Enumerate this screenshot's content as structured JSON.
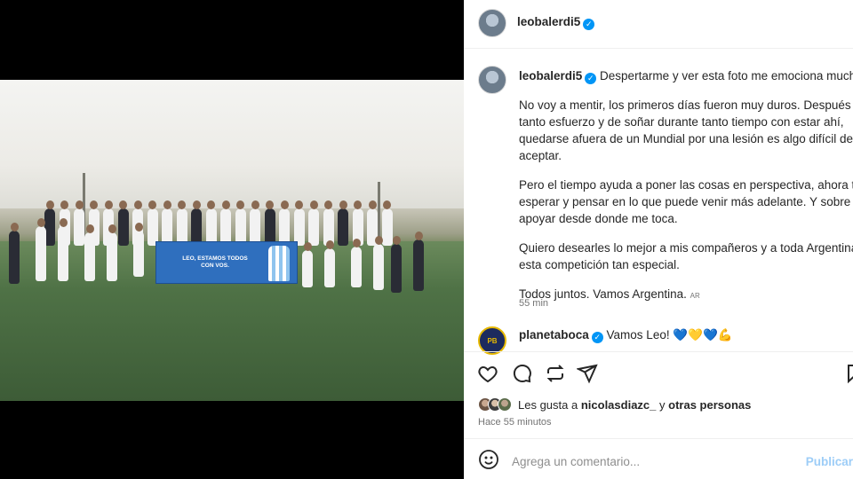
{
  "media": {
    "banner_text": "LEO, ESTAMOS TODOS\nCON VOS."
  },
  "header": {
    "username": "leobalerdi5"
  },
  "caption": {
    "username": "leobalerdi5",
    "first_line": "Despertarme y ver esta foto me emociona mucho.",
    "paragraphs": [
      [
        "No voy a mentir, los primeros días fueron muy duros. Después de",
        "tanto esfuerzo y de soñar durante tanto tiempo con estar ahí,",
        "quedarse afuera de un Mundial por una lesión es algo difícil de",
        "aceptar."
      ],
      [
        "Pero el tiempo ayuda a poner las cosas en perspectiva, ahora toca",
        "esperar y pensar en lo que puede venir más adelante. Y sobre todo",
        "apoyar desde donde me toca."
      ],
      [
        "Quiero desearles lo mejor a mis compañeros y a toda Argentina en",
        "esta competición tan especial."
      ],
      [
        "Todos juntos. Vamos Argentina."
      ]
    ],
    "flag_code": "AR",
    "time": "55 min"
  },
  "comment": {
    "username": "planetaboca",
    "avatar_text": "PB",
    "text": "Vamos Leo!",
    "emojis": [
      "💙",
      "💛",
      "💙",
      "💪"
    ]
  },
  "likes": {
    "prefix": "Les gusta a",
    "user": "nicolasdiazc_",
    "middle": "y",
    "suffix": "otras personas"
  },
  "posted_ago": "Hace 55 minutos",
  "add_comment": {
    "placeholder": "Agrega un comentario...",
    "publish_label": "Publicar"
  },
  "icons": {
    "like": "heart-icon",
    "comment": "comment-icon",
    "share": "repost-icon",
    "send": "send-icon",
    "save": "bookmark-icon",
    "emoji": "smiley-icon",
    "verified": "verified-badge-icon"
  },
  "colors": {
    "verified": "#0095f6",
    "publish": "#9dcdf7",
    "muted": "#737373"
  }
}
